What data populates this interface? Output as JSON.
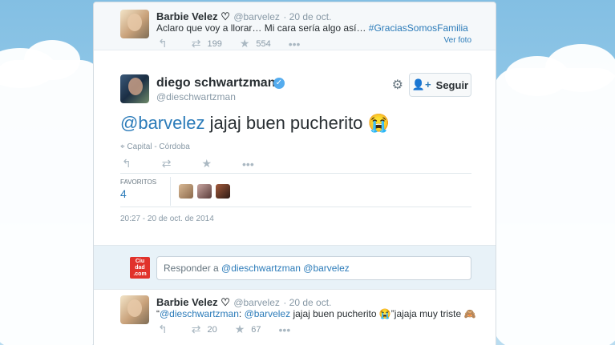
{
  "tweet1": {
    "name": "Barbie Velez ♡",
    "handle": "@barvelez",
    "time": "· 20 de oct.",
    "text_before": "Aclaro que voy a llorar… Mi cara sería algo así… ",
    "hashtag": "#GraciasSomosFamilia",
    "see_photo": "Ver foto",
    "retweets": "199",
    "favorites": "554"
  },
  "main_tweet": {
    "name": "diego schwartzman",
    "handle": "@dieschwartzman",
    "follow_label": "Seguir",
    "mention": "@barvelez",
    "text": " jajaj buen pucherito 😭",
    "location": "Capital - Córdoba",
    "favorites_label": "FAVORITOS",
    "favorites_count": "4",
    "timestamp": "20:27 - 20 de oct. de 2014"
  },
  "reply": {
    "placeholder_prefix": "Responder a ",
    "mentions": "@dieschwartzman @barvelez",
    "logo_text": "Ciu dad .com"
  },
  "tweet3": {
    "name": "Barbie Velez ♡",
    "handle": "@barvelez",
    "time": "· 20 de oct.",
    "quote_open": "“",
    "mention1": "@dieschwartzman",
    "colon": ": ",
    "mention2": "@barvelez",
    "text": " jajaj buen pucherito 😭”jajaja muy triste 🙈",
    "retweets": "20",
    "favorites": "67"
  },
  "icons": [
    "reply-icon",
    "retweet-icon",
    "favorite-icon",
    "more-icon",
    "gear-icon",
    "follow-icon",
    "location-icon"
  ],
  "colors": {
    "link": "#2b7bb9",
    "muted": "#8899a6",
    "sky": "#8ec2e2"
  }
}
